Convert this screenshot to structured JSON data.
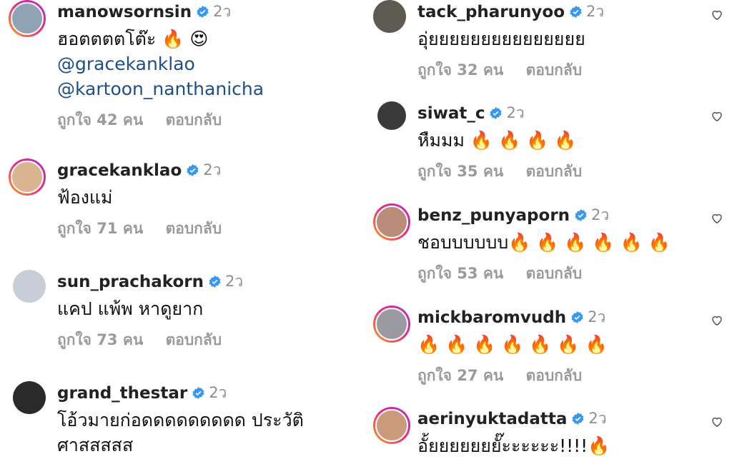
{
  "left_comments": [
    {
      "username": "manowsornsin",
      "age": "2ว",
      "lines": [
        "ฮอตตตตโต๊ะ 🔥 😍"
      ],
      "mentions": [
        "@gracekanklao",
        "@kartoon_nanthanicha"
      ],
      "likes": "ถูกใจ 42 คน",
      "reply": "ตอบกลับ",
      "avatar_color": "#8fa3b5"
    },
    {
      "username": "gracekanklao",
      "age": "2ว",
      "lines": [
        "ฟ้องแม่"
      ],
      "likes": "ถูกใจ 71 คน",
      "reply": "ตอบกลับ",
      "avatar_color": "#d9b48f"
    },
    {
      "username": "sun_prachakorn",
      "age": "2ว",
      "lines": [
        "แคป แพ้พ หาดูยาก"
      ],
      "likes": "ถูกใจ 73 คน",
      "reply": "ตอบกลับ",
      "avatar_color": "#c8ced8"
    },
    {
      "username": "grand_thestar",
      "age": "2ว",
      "lines": [
        "โอ้วมายก่อดดดดดดดดด ประวัติ",
        "ศาสสสสส"
      ],
      "likes": "",
      "reply": "",
      "avatar_color": "#2a2a2a"
    }
  ],
  "right_comments": [
    {
      "username": "tack_pharunyoo",
      "age": "2ว",
      "lines": [
        "อุ่ยยยยยยยยยยยยยยย"
      ],
      "likes": "ถูกใจ 32 คน",
      "reply": "ตอบกลับ",
      "avatar_color": "#5d5a52"
    },
    {
      "username": "siwat_c",
      "age": "2ว",
      "lines": [
        "หืมมม 🔥 🔥 🔥 🔥"
      ],
      "likes": "ถูกใจ 35 คน",
      "reply": "ตอบกลับ",
      "avatar_color": "#3a3a3a"
    },
    {
      "username": "benz_punyaporn",
      "age": "2ว",
      "lines": [
        "ชอบบบบบบ🔥 🔥 🔥 🔥 🔥 🔥"
      ],
      "likes": "ถูกใจ 53 คน",
      "reply": "ตอบกลับ",
      "avatar_color": "#b98d7a"
    },
    {
      "username": "mickbaromvudh",
      "age": "2ว",
      "lines": [
        "🔥 🔥 🔥 🔥 🔥 🔥 🔥"
      ],
      "likes": "ถูกใจ 27 คน",
      "reply": "ตอบกลับ",
      "avatar_color": "#9a9aa0"
    },
    {
      "username": "aerinyuktadatta",
      "age": "2ว",
      "lines": [
        "อั้ยยยยยยยั๊ะะะะะะ!!!!🔥"
      ],
      "likes": "",
      "reply": "",
      "avatar_color": "#c99b7a"
    }
  ],
  "colors": {
    "verified": "#3897f0",
    "meta": "#9a9a9a",
    "mention": "#1e4f8a"
  },
  "icons": [
    "verified-badge-icon",
    "heart-icon"
  ]
}
